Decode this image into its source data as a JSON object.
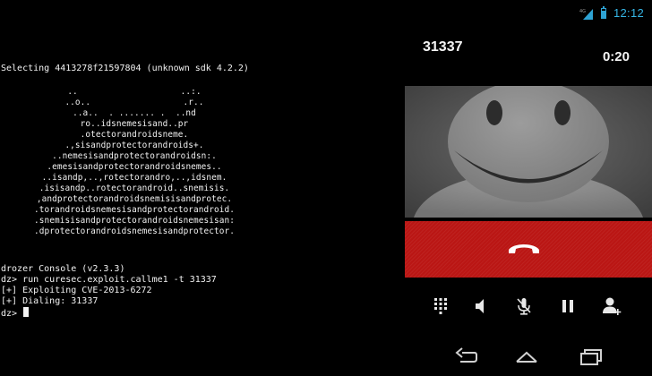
{
  "terminal": {
    "selecting_line": "Selecting 4413278f21597804 (unknown sdk 4.2.2)",
    "banner": [
      "..                    ..:.",
      "..o..                  .r..",
      "..a..  . ....... .  ..nd",
      "ro..idsnemesisand..pr",
      ".otectorandroidsneme.",
      ".,sisandprotectorandroids+.",
      "..nemesisandprotectorandroidsn:.",
      ".emesisandprotectorandroidsnemes..",
      "..isandp,..,rotectorandro,..,idsnem.",
      ".isisandp..rotectorandroid..snemisis.",
      ",andprotectorandroidsnemisisandprotec.",
      ".torandroidsnemesisandprotectorandroid.",
      ".snemisisandprotectorandroidsnemesisan:",
      ".dprotectorandroidsnemesisandprotector."
    ],
    "console_lines": [
      "drozer Console (v2.3.3)",
      "dz> run curesec.exploit.callme1 -t 31337",
      "[+] Exploiting CVE-2013-6272",
      "[+] Dialing: 31337"
    ],
    "prompt": "dz> "
  },
  "phone": {
    "status_bar": {
      "clock": "12:12",
      "signal_icon": "signal-icon",
      "battery_icon": "battery-icon",
      "accent_color": "#35b5e5"
    },
    "caller_number": "31337",
    "call_timer": "0:20",
    "photo_icon": "default-contact-avatar",
    "end_call_color": "#ba1614",
    "end_call_icon": "end-call-icon",
    "controls": [
      "dialpad-icon",
      "speaker-icon",
      "mute-microphone-icon",
      "hold-pause-icon",
      "add-call-icon"
    ],
    "nav_buttons": [
      "back-icon",
      "home-icon",
      "recent-apps-icon"
    ]
  }
}
